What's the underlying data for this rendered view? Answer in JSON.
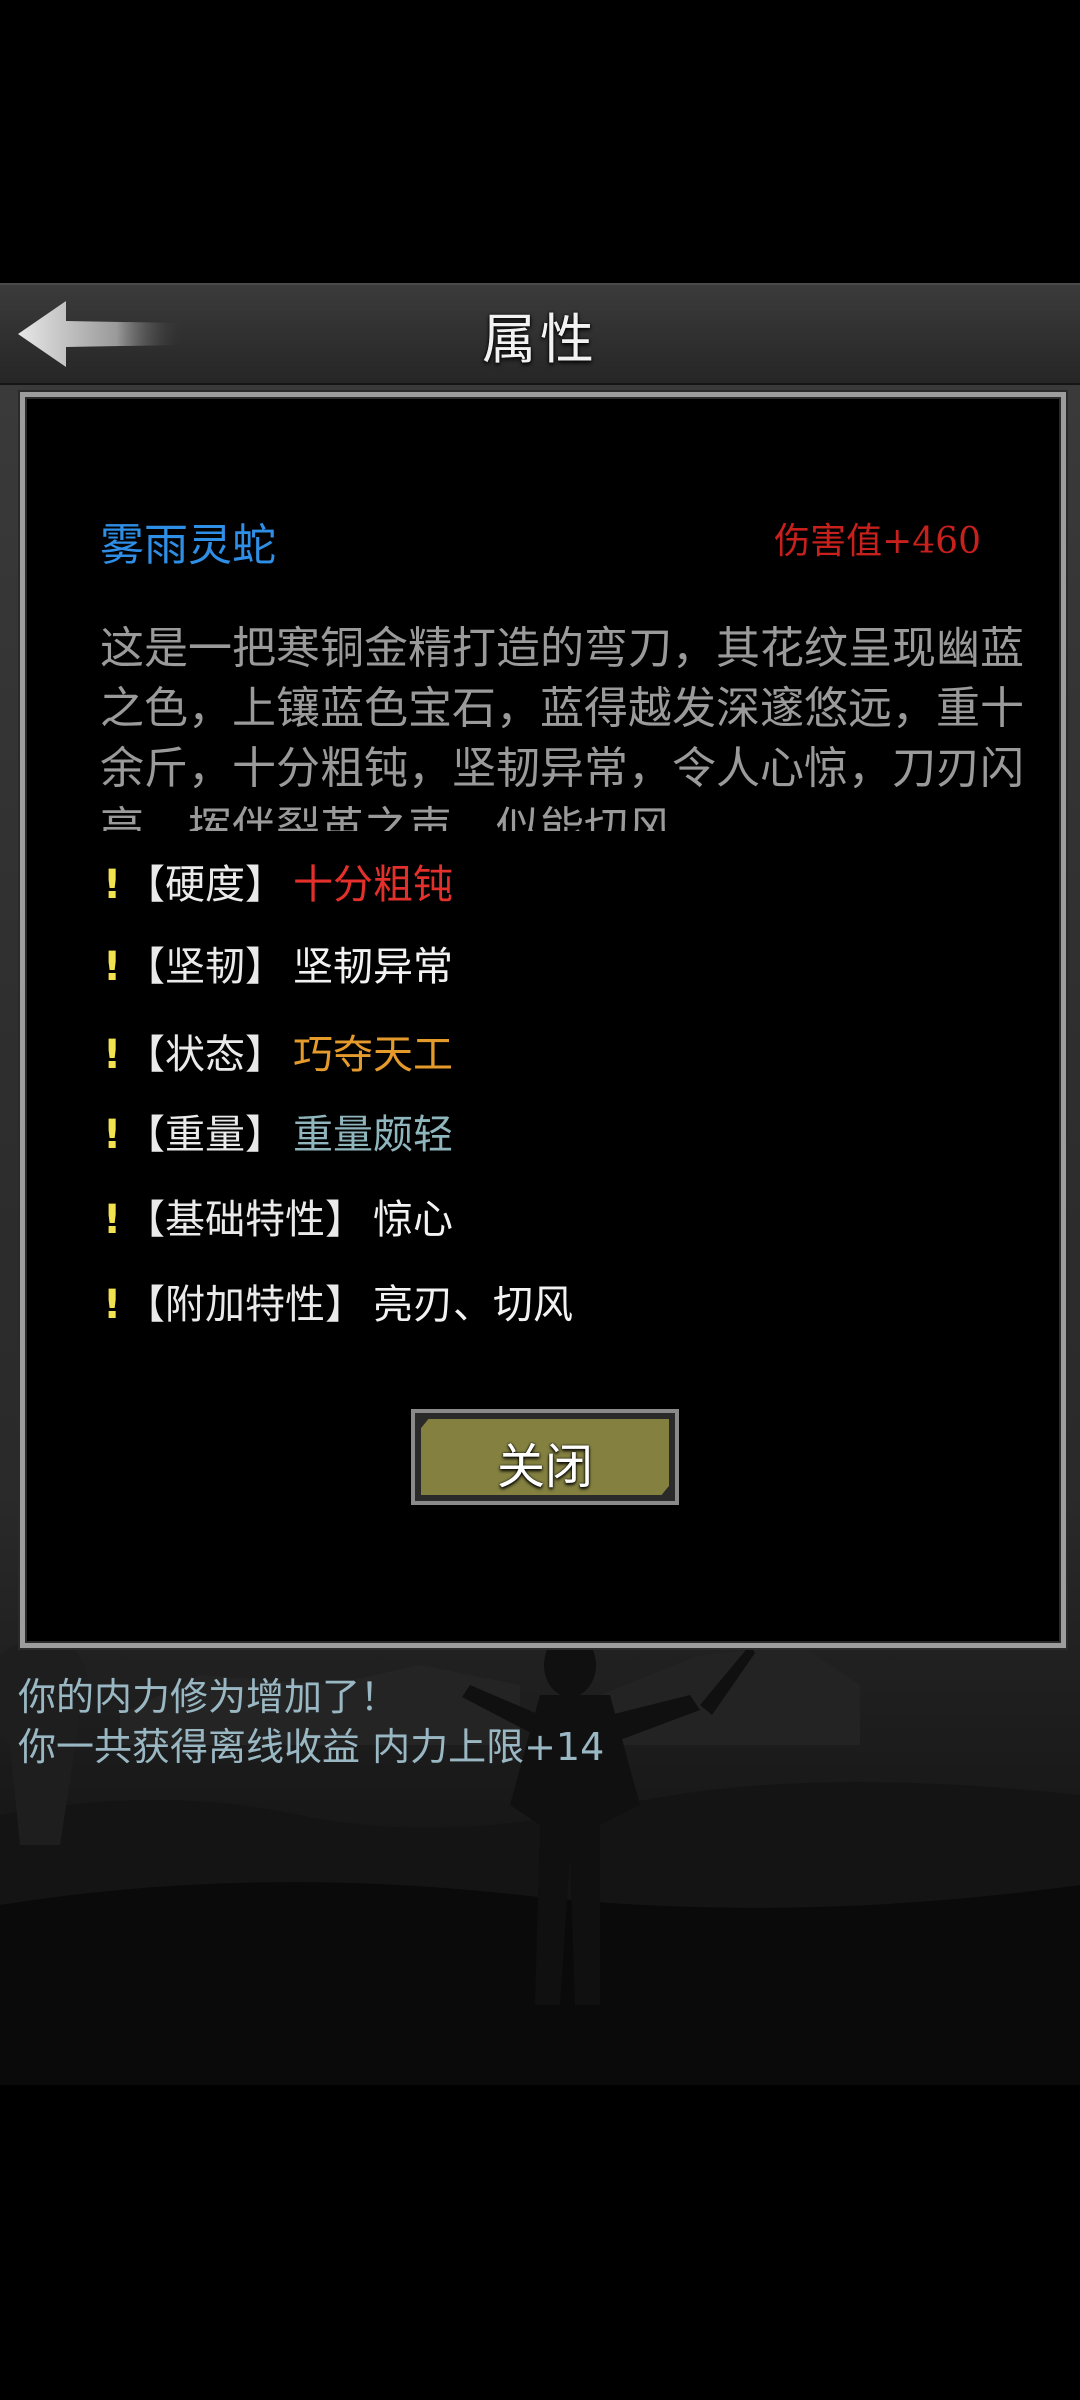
{
  "header": {
    "title": "属性"
  },
  "item": {
    "name": "雾雨灵蛇",
    "damage": "伤害值+460",
    "description": "这是一把寒铜金精打造的弯刀，其花纹呈现幽蓝之色，上镶蓝色宝石，蓝得越发深邃悠远，重十余斤，十分粗钝，坚韧异常，令人心惊，刀刃闪亮，挥伴裂革之声，似能切风"
  },
  "attributes": [
    {
      "icon": "exclamation-icon",
      "bang": "!",
      "key": "【硬度】",
      "value": "十分粗钝",
      "color": "#e3302a"
    },
    {
      "icon": "exclamation-icon",
      "bang": "!",
      "key": "【坚韧】",
      "value": "坚韧异常",
      "color": "#f2f2f2"
    },
    {
      "icon": "exclamation-icon",
      "bang": "!",
      "key": "【状态】",
      "value": "巧夺天工",
      "color": "#e59a2c"
    },
    {
      "icon": "exclamation-icon",
      "bang": "!",
      "key": "【重量】",
      "value": "重量颇轻",
      "color": "#8fb6bd"
    },
    {
      "icon": "exclamation-icon",
      "bang": "!",
      "key": "【基础特性】",
      "value": "惊心",
      "color": "#f2f2f2"
    },
    {
      "icon": "exclamation-icon",
      "bang": "!",
      "key": "【附加特性】",
      "value": "亮刃、切风",
      "color": "#f2f2f2"
    }
  ],
  "close_button": {
    "label": "关闭"
  },
  "log": [
    "你的内力修为增加了！",
    "你一共获得离线收益 内力上限+14"
  ],
  "colors": {
    "item_name": "#2f8ee6",
    "damage": "#c8201c",
    "description": "#9a9a9a",
    "bang": "#f2e250",
    "button_fill": "#838040",
    "log": "#9ab8c4"
  }
}
